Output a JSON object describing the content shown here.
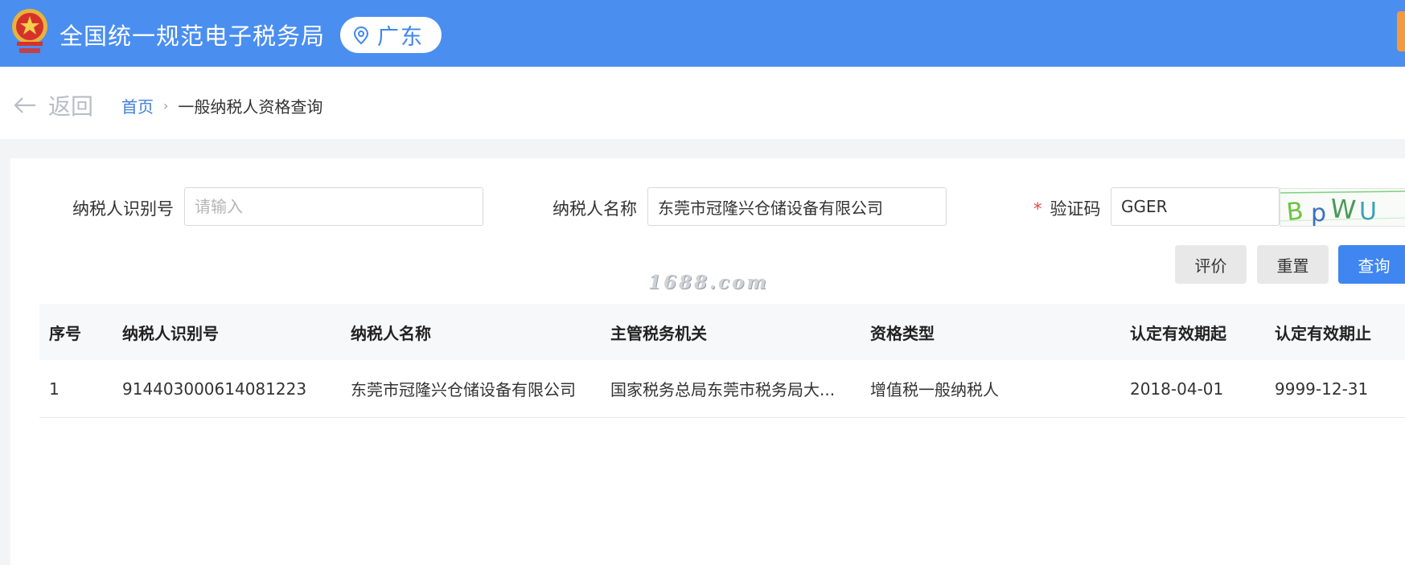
{
  "header": {
    "title": "全国统一规范电子税务局",
    "region": "广东",
    "colors": {
      "bar": "#4a8ef0",
      "accent": "#3f86f0"
    }
  },
  "breadcrumb": {
    "back_label": "返回",
    "home": "首页",
    "current": "一般纳税人资格查询"
  },
  "form": {
    "taxpayer_id": {
      "label": "纳税人识别号",
      "value": "",
      "placeholder": "请输入"
    },
    "taxpayer_name": {
      "label": "纳税人名称",
      "value": "东莞市冠隆兴仓储设备有限公司",
      "placeholder": ""
    },
    "captcha": {
      "required_mark": "*",
      "label": "验证码",
      "value": "GGER"
    }
  },
  "buttons": {
    "rate": "评价",
    "reset": "重置",
    "query": "查询"
  },
  "watermark": "1688.com",
  "table": {
    "columns": [
      "序号",
      "纳税人识别号",
      "纳税人名称",
      "主管税务机关",
      "资格类型",
      "认定有效期起",
      "认定有效期止"
    ],
    "rows": [
      [
        "1",
        "91440300061408122​3",
        "东莞市冠隆兴仓储设备有限公司",
        "国家税务总局东莞市税务局大...",
        "增值税一般纳税人",
        "2018-04-01",
        "9999-12-31"
      ]
    ]
  }
}
